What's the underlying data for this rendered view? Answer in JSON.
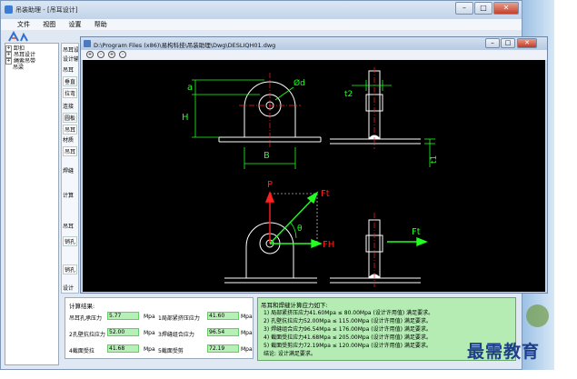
{
  "main_window": {
    "title": "吊装助理 - [吊耳设计]",
    "controls": {
      "minimize": "–",
      "maximize": "□",
      "close": "✕"
    }
  },
  "menu": [
    "文件",
    "视图",
    "设置",
    "帮助"
  ],
  "tree": {
    "items": [
      {
        "label": "卸扣",
        "expander": "+"
      },
      {
        "label": "吊耳设计",
        "expander": "+"
      },
      {
        "label": "绳索吊带",
        "expander": "+"
      },
      {
        "label": "吊梁",
        "expander": ""
      }
    ]
  },
  "left_panel": {
    "tabs": [
      "吊耳设计",
      "设计输入"
    ],
    "labels": [
      "吊耳",
      "垂直",
      "拉弯",
      "连接",
      "圆板",
      "吊耳",
      "材质",
      "吊耳",
      "焊缝",
      "计算",
      "吊耳",
      "销孔",
      "销孔",
      "设计"
    ]
  },
  "calc": {
    "header": "计算结果:",
    "rows": [
      {
        "label": "吊耳孔承压力",
        "value": "5.77",
        "unit": "Mpa",
        "label2": "1局部紧挤压应力",
        "value2": "41.60",
        "unit2": "Mpa"
      },
      {
        "label": "2孔壁抗拉应力",
        "value": "52.00",
        "unit": "Mpa",
        "label2": "3焊缝组合应力",
        "value2": "96.54",
        "unit2": "Mpa"
      },
      {
        "label": "4截面受拉",
        "value": "41.68",
        "unit": "Mpa",
        "label2": "5截面受剪",
        "value2": "72.19",
        "unit2": "Mpa"
      }
    ]
  },
  "results": {
    "header": "吊耳和焊缝计算应力如下:",
    "lines": [
      "1) 局部紧挤压应力41.60Mpa ≤ 80.00Mpa (设计许用值) 满足要求。",
      "2) 孔壁抗拉应力52.00Mpa ≤ 115.00Mpa (设计许用值) 满足要求。",
      "3) 焊缝组合应力96.54Mpa ≤ 176.00Mpa (设计许用值) 满足要求。",
      "4) 截面受拉应力41.68Mpa ≤ 205.00Mpa (设计许用值) 满足要求。",
      "5) 截面受剪应力72.19Mpa ≤ 120.00Mpa (设计许用值) 满足要求。",
      "结论: 设计满足要求。"
    ]
  },
  "drawing_window": {
    "path": "D:\\Program Files (x86)\\易构科技\\吊装助理\\Dwg\\DESLIQH01.dwg",
    "zoom_tools": [
      "+",
      "-",
      "+",
      "-"
    ],
    "labels": {
      "a": "a",
      "d": "Ød",
      "H": "H",
      "B": "B",
      "t2": "t2",
      "t1": "t1",
      "P": "P",
      "Ft": "Ft",
      "FH": "FH",
      "theta": "θ",
      "Ft2": "Ft"
    },
    "colors": {
      "red": "#ff2020",
      "green": "#20ff20",
      "white": "#ffffff",
      "grey": "#b0b0b0"
    }
  },
  "watermark": "最需教育"
}
